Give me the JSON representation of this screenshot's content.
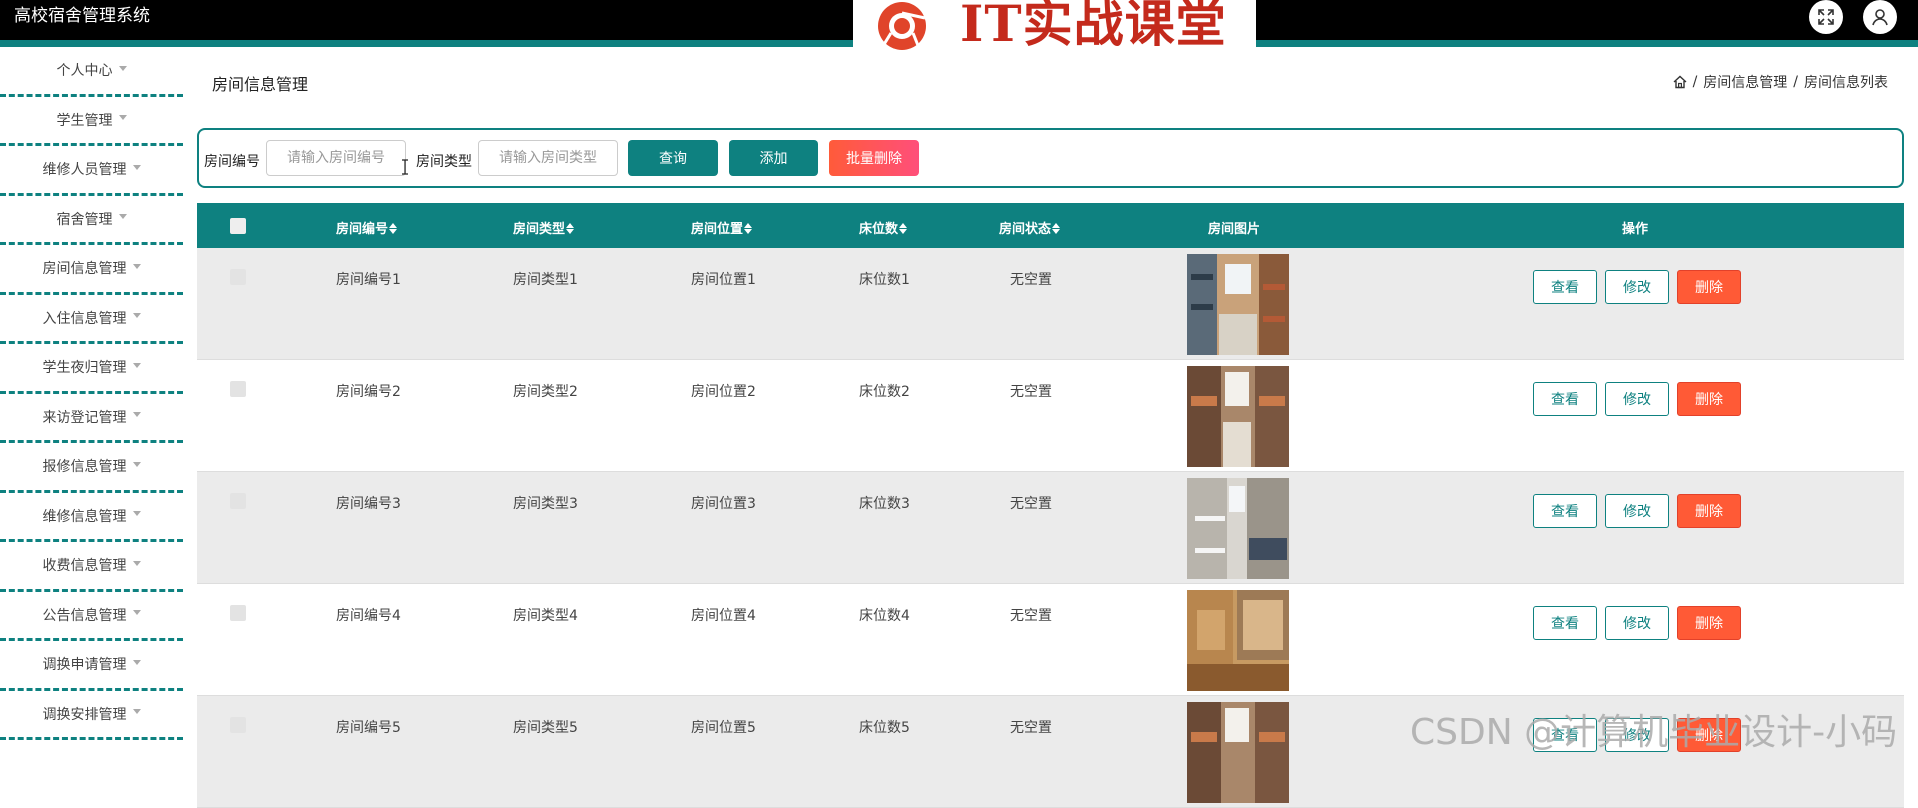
{
  "app": {
    "title": "高校宿舍管理系统"
  },
  "brand": {
    "text": "IT实战课堂"
  },
  "top_icons": [
    "fullscreen-icon",
    "user-icon"
  ],
  "colors": {
    "primary": "#0e8180",
    "danger": "#ff5a36",
    "header_bg": "#000000",
    "brand_red": "#c42a1c"
  },
  "sidebar": {
    "items": [
      {
        "label": "个人中心"
      },
      {
        "label": "学生管理"
      },
      {
        "label": "维修人员管理"
      },
      {
        "label": "宿舍管理"
      },
      {
        "label": "房间信息管理"
      },
      {
        "label": "入住信息管理"
      },
      {
        "label": "学生夜归管理"
      },
      {
        "label": "来访登记管理"
      },
      {
        "label": "报修信息管理"
      },
      {
        "label": "维修信息管理"
      },
      {
        "label": "收费信息管理"
      },
      {
        "label": "公告信息管理"
      },
      {
        "label": "调换申请管理"
      },
      {
        "label": "调换安排管理"
      }
    ]
  },
  "page": {
    "title": "房间信息管理",
    "breadcrumb": [
      "房间信息管理",
      "房间信息列表"
    ]
  },
  "search": {
    "room_no_label": "房间编号",
    "room_no_placeholder": "请输入房间编号",
    "room_type_label": "房间类型",
    "room_type_placeholder": "请输入房间类型",
    "query_label": "查询",
    "add_label": "添加",
    "batch_delete_label": "批量删除"
  },
  "table": {
    "headers": {
      "room_no": "房间编号",
      "room_type": "房间类型",
      "room_location": "房间位置",
      "beds": "床位数",
      "status": "房间状态",
      "image": "房间图片",
      "actions": "操作"
    },
    "rows": [
      {
        "room_no": "房间编号1",
        "room_type": "房间类型1",
        "room_location": "房间位置1",
        "beds": "床位数1",
        "status": "无空置"
      },
      {
        "room_no": "房间编号2",
        "room_type": "房间类型2",
        "room_location": "房间位置2",
        "beds": "床位数2",
        "status": "无空置"
      },
      {
        "room_no": "房间编号3",
        "room_type": "房间类型3",
        "room_location": "房间位置3",
        "beds": "床位数3",
        "status": "无空置"
      },
      {
        "room_no": "房间编号4",
        "room_type": "房间类型4",
        "room_location": "房间位置4",
        "beds": "床位数4",
        "status": "无空置"
      },
      {
        "room_no": "房间编号5",
        "room_type": "房间类型5",
        "room_location": "房间位置5",
        "beds": "床位数5",
        "status": "无空置"
      }
    ],
    "action_labels": {
      "view": "查看",
      "edit": "修改",
      "delete": "删除"
    }
  },
  "watermark": "CSDN @计算机毕业设计-小码"
}
